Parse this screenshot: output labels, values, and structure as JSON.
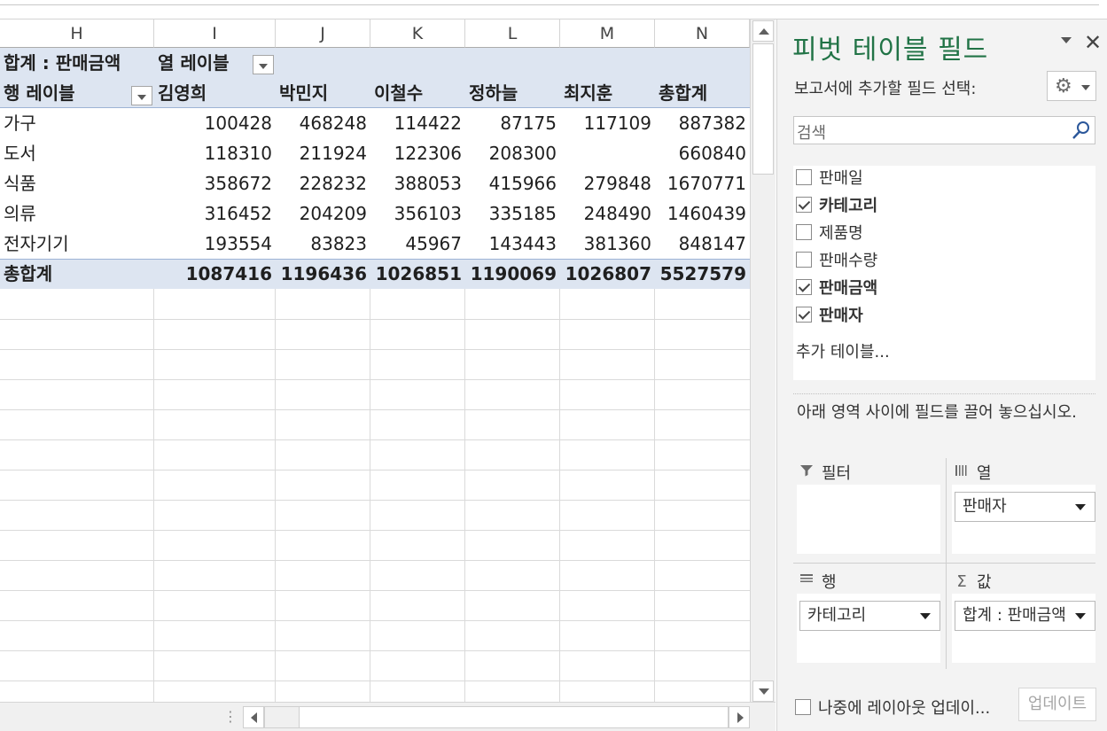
{
  "columns": [
    "H",
    "I",
    "J",
    "K",
    "L",
    "M",
    "N"
  ],
  "pivot": {
    "value_field_label": "합계 : 판매금액",
    "col_labels_caption": "열 레이블",
    "row_labels_caption": "행 레이블",
    "column_names": [
      "김영희",
      "박민지",
      "이철수",
      "정하늘",
      "최지훈",
      "총합계"
    ],
    "rows": [
      {
        "label": "가구",
        "values": [
          "100428",
          "468248",
          "114422",
          "87175",
          "117109",
          "887382"
        ]
      },
      {
        "label": "도서",
        "values": [
          "118310",
          "211924",
          "122306",
          "208300",
          "",
          "660840"
        ]
      },
      {
        "label": "식품",
        "values": [
          "358672",
          "228232",
          "388053",
          "415966",
          "279848",
          "1670771"
        ]
      },
      {
        "label": "의류",
        "values": [
          "316452",
          "204209",
          "356103",
          "335185",
          "248490",
          "1460439"
        ]
      },
      {
        "label": "전자기기",
        "values": [
          "193554",
          "83823",
          "45967",
          "143443",
          "381360",
          "848147"
        ]
      }
    ],
    "total": {
      "label": "총합계",
      "values": [
        "1087416",
        "1196436",
        "1026851",
        "1190069",
        "1026807",
        "5527579"
      ]
    }
  },
  "panel": {
    "title": "피벗 테이블 필드",
    "choose_label": "보고서에 추가할 필드 선택:",
    "search_placeholder": "검색",
    "fields": [
      {
        "label": "판매일",
        "checked": false
      },
      {
        "label": "카테고리",
        "checked": true
      },
      {
        "label": "제품명",
        "checked": false
      },
      {
        "label": "판매수량",
        "checked": false
      },
      {
        "label": "판매금액",
        "checked": true
      },
      {
        "label": "판매자",
        "checked": true
      }
    ],
    "more_tables": "추가 테이블...",
    "drag_hint": "아래 영역 사이에 필드를 끌어 놓으십시오.",
    "areas": {
      "filter": {
        "label": "필터",
        "items": []
      },
      "columns": {
        "label": "열",
        "items": [
          "판매자"
        ]
      },
      "rows": {
        "label": "행",
        "items": [
          "카테고리"
        ]
      },
      "values": {
        "label": "값",
        "items": [
          "합계 : 판매금액"
        ]
      }
    },
    "defer_label": "나중에 레이아웃 업데이...",
    "update_button": "업데이트"
  }
}
